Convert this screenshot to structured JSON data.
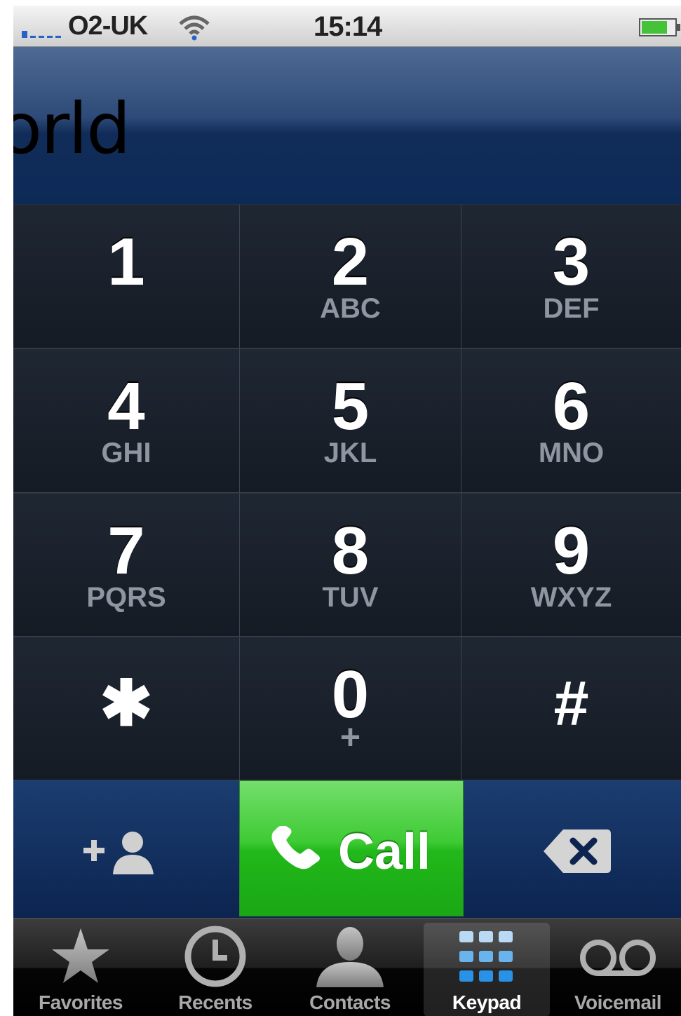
{
  "status_bar": {
    "carrier": "O2-UK",
    "time": "15:14",
    "signal_icon": "signal-bars-icon",
    "wifi_icon": "wifi-icon",
    "battery_icon": "battery-icon"
  },
  "display": {
    "text": "orld"
  },
  "keypad": {
    "keys": [
      {
        "digit": "1",
        "letters": ""
      },
      {
        "digit": "2",
        "letters": "ABC"
      },
      {
        "digit": "3",
        "letters": "DEF"
      },
      {
        "digit": "4",
        "letters": "GHI"
      },
      {
        "digit": "5",
        "letters": "JKL"
      },
      {
        "digit": "6",
        "letters": "MNO"
      },
      {
        "digit": "7",
        "letters": "PQRS"
      },
      {
        "digit": "8",
        "letters": "TUV"
      },
      {
        "digit": "9",
        "letters": "WXYZ"
      },
      {
        "digit": "✱",
        "letters": ""
      },
      {
        "digit": "0",
        "letters": "+"
      },
      {
        "digit": "#",
        "letters": ""
      }
    ]
  },
  "actions": {
    "add_contact_icon": "add-contact-icon",
    "call_label": "Call",
    "call_icon": "phone-handset-icon",
    "delete_icon": "backspace-icon",
    "call_color": "#3fcb35"
  },
  "tab_bar": {
    "tabs": [
      {
        "label": "Favorites",
        "icon": "star-icon",
        "active": false
      },
      {
        "label": "Recents",
        "icon": "clock-icon",
        "active": false
      },
      {
        "label": "Contacts",
        "icon": "person-icon",
        "active": false
      },
      {
        "label": "Keypad",
        "icon": "keypad-icon",
        "active": true
      },
      {
        "label": "Voicemail",
        "icon": "voicemail-icon",
        "active": false
      }
    ]
  }
}
